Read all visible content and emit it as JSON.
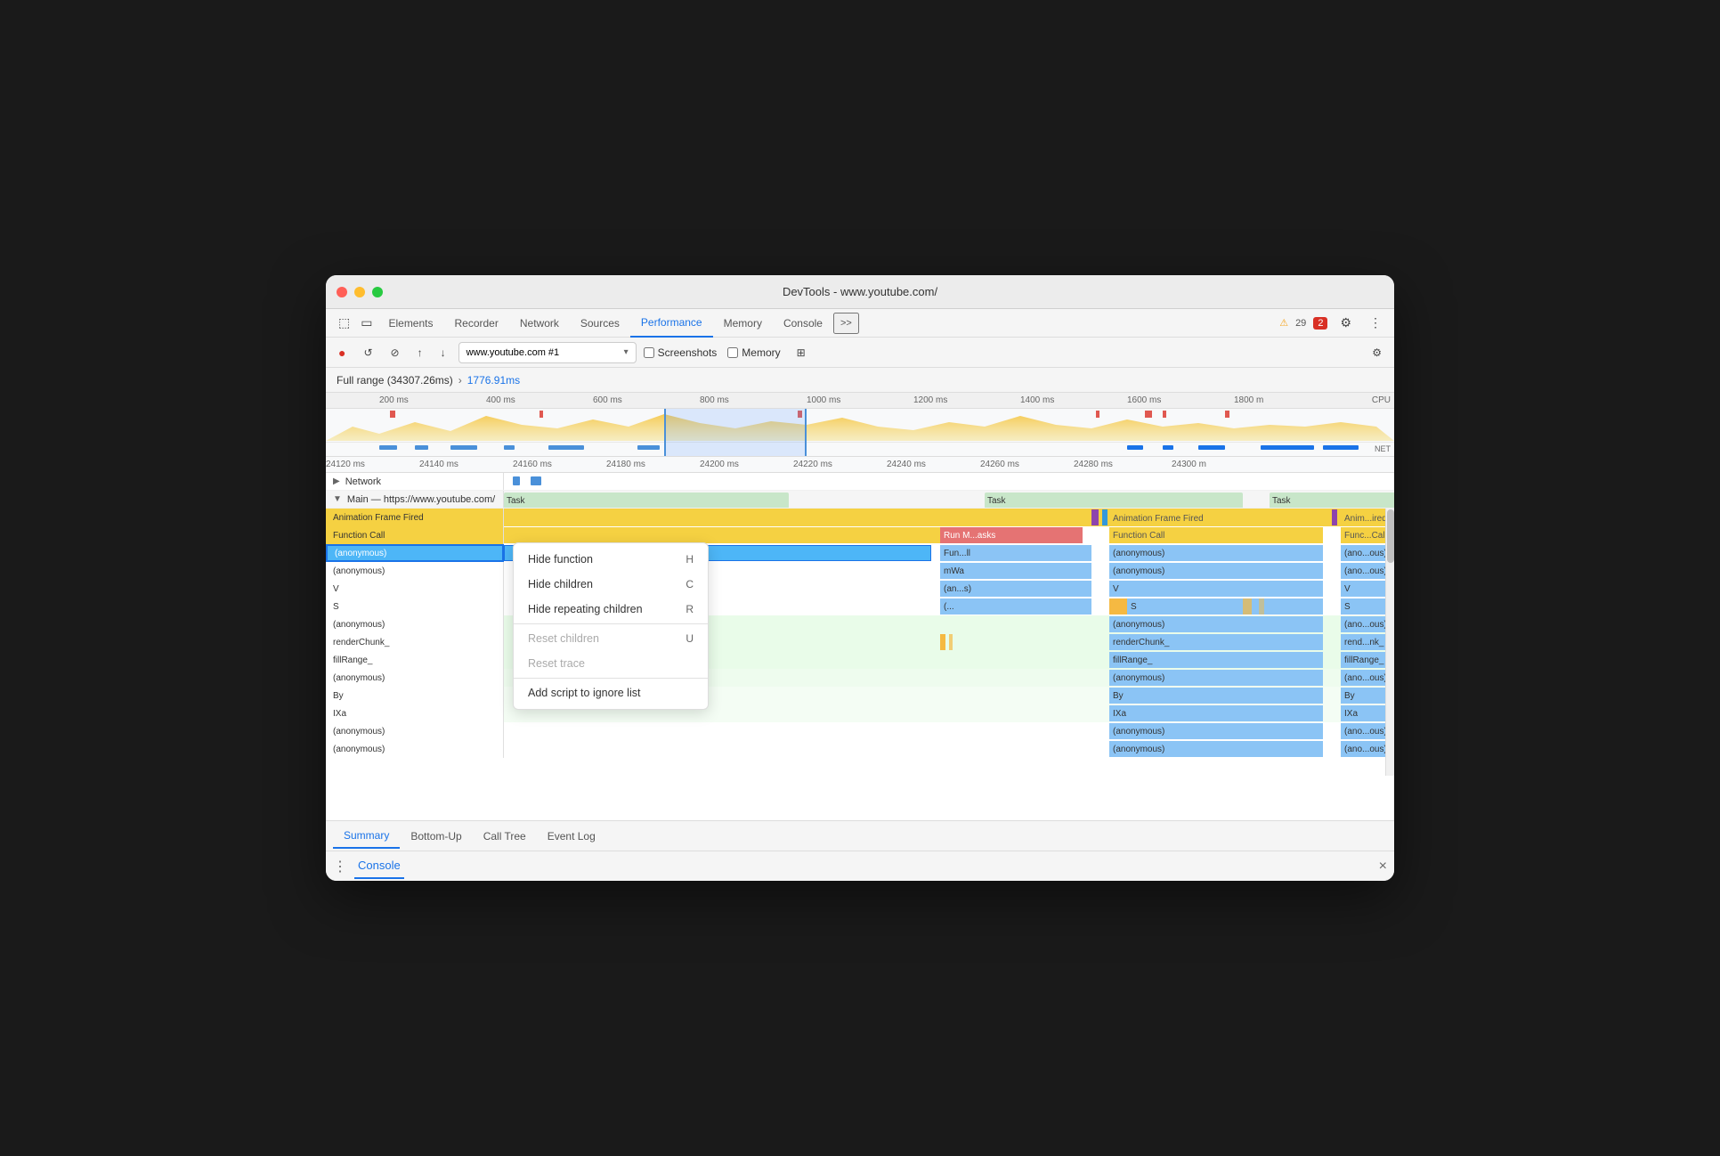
{
  "window": {
    "title": "DevTools - www.youtube.com/"
  },
  "tabs": [
    {
      "label": "Elements",
      "active": false
    },
    {
      "label": "Recorder",
      "active": false
    },
    {
      "label": "Network",
      "active": false
    },
    {
      "label": "Sources",
      "active": false
    },
    {
      "label": "Performance",
      "active": true
    },
    {
      "label": "Memory",
      "active": false
    },
    {
      "label": "Console",
      "active": false
    }
  ],
  "toolbar": {
    "record_label": "●",
    "reload_label": "↺",
    "clear_label": "⊘",
    "upload_label": "↑",
    "download_label": "↓",
    "address": "www.youtube.com #1",
    "screenshots_label": "Screenshots",
    "memory_label": "Memory"
  },
  "breadcrumb": {
    "full_range": "Full range (34307.26ms)",
    "arrow": "›",
    "selected": "1776.91ms"
  },
  "ruler": {
    "ticks": [
      "200 ms",
      "400 ms",
      "600 ms",
      "800 ms",
      "1000 ms",
      "1200 ms",
      "1400 ms",
      "1600 ms",
      "1800 m"
    ],
    "detail_ticks": [
      "24120 ms",
      "24140 ms",
      "24160 ms",
      "24180 ms",
      "24200 ms",
      "24220 ms",
      "24240 ms",
      "24260 ms",
      "24280 ms",
      "24300 m"
    ]
  },
  "network_row": {
    "label": "Network"
  },
  "main_row": {
    "label": "Main — https://www.youtube.com/"
  },
  "tracks": {
    "task_label": "Task",
    "animation_frame_label": "Animation Frame Fired",
    "function_call_label": "Function Call",
    "anonymous_label": "(anonymous)",
    "mwa_label": "mWa",
    "v_label": "V",
    "s_label": "S",
    "renderchunk_label": "renderChunk_",
    "fillrange_label": "fillRange_",
    "by_label": "By",
    "ixa_label": "IXa",
    "run_masks_label": "Run M...asks",
    "fun_ll_label": "Fun...ll",
    "an_s_label": "(an...s)",
    "ellipsis_label": "(...",
    "rend_nk_label": "rend...nk_",
    "anon_ous_label": "(ano...ous)",
    "func_call_label": "Func...Call",
    "anim_ired_label": "Anim...ired"
  },
  "context_menu": {
    "items": [
      {
        "label": "Hide function",
        "shortcut": "H",
        "disabled": false
      },
      {
        "label": "Hide children",
        "shortcut": "C",
        "disabled": false
      },
      {
        "label": "Hide repeating children",
        "shortcut": "R",
        "disabled": false
      },
      {
        "label": "Reset children",
        "shortcut": "U",
        "disabled": true
      },
      {
        "label": "Reset trace",
        "shortcut": "",
        "disabled": true
      },
      {
        "label": "Add script to ignore list",
        "shortcut": "",
        "disabled": false
      }
    ]
  },
  "bottom_tabs": [
    {
      "label": "Summary",
      "active": true
    },
    {
      "label": "Bottom-Up",
      "active": false
    },
    {
      "label": "Call Tree",
      "active": false
    },
    {
      "label": "Event Log",
      "active": false
    }
  ],
  "console_bar": {
    "menu_icon": "⋮",
    "console_label": "Console",
    "close_icon": "×"
  },
  "status": {
    "warnings": "29",
    "errors": "2"
  },
  "colors": {
    "task": "#c8e6c9",
    "animation_frame": "#f5d142",
    "function_call": "#f5d142",
    "anonymous": "#8bc4f5",
    "selected_anonymous": "#4db6f7",
    "v": "#8bc4f5",
    "s": "#f5b942",
    "renderchunk": "#8bc4f5",
    "fillrange": "#8bc4f5",
    "by": "#8bc4f5",
    "ixa": "#8bc4f5",
    "run_masks": "#e57373",
    "network_bar": "#4a90d9"
  }
}
